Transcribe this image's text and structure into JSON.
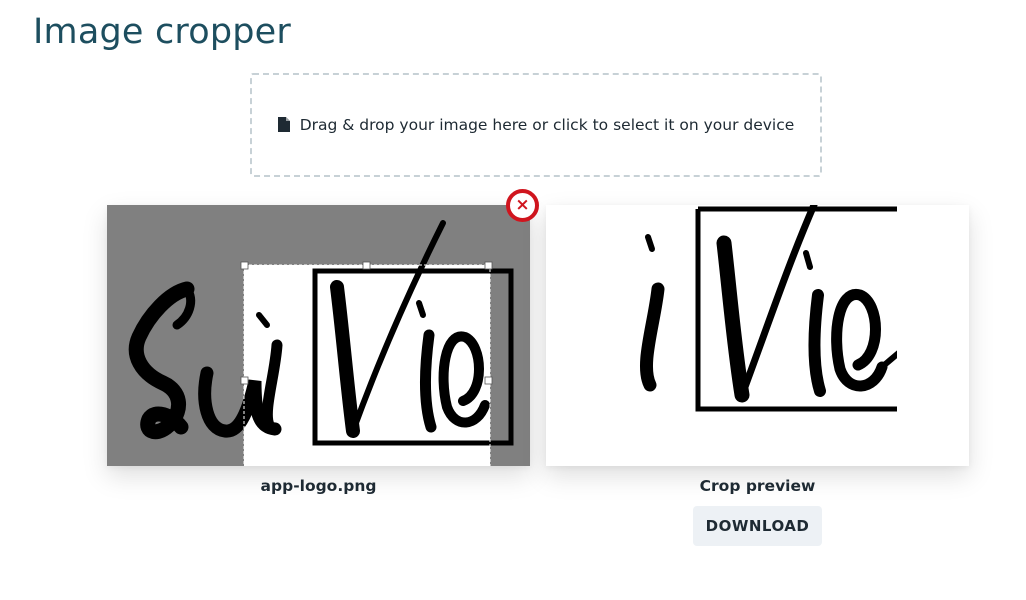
{
  "page": {
    "title": "Image cropper"
  },
  "dropzone": {
    "label": "Drag & drop your image here or click to select it on your device",
    "icon": "file-icon"
  },
  "source": {
    "filename": "app-logo.png",
    "logo_text": "SuiVie",
    "remove_icon": "close-icon",
    "remove_glyph": "×"
  },
  "preview": {
    "caption": "Crop preview",
    "download_label": "DOWNLOAD"
  },
  "colors": {
    "title": "#1d4e5f",
    "remove_accent": "#d0151e",
    "overlay": "#808080",
    "button_bg": "#edf1f5"
  }
}
